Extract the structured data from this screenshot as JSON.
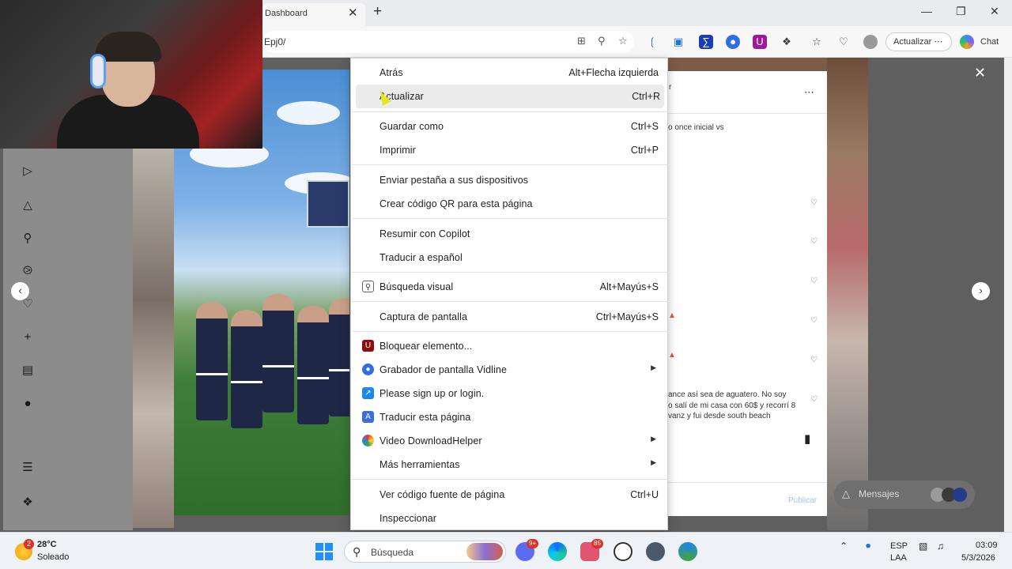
{
  "browser": {
    "tab_title": "Dashboard",
    "url": "Epj0/",
    "update_label": "Actualizar",
    "update_more": "⋯",
    "chat_label": "Chat"
  },
  "context_menu": {
    "items": [
      {
        "label": "Atrás",
        "shortcut": "Alt+Flecha izquierda"
      },
      {
        "label": "Actualizar",
        "shortcut": "Ctrl+R"
      },
      {
        "label": "Guardar como",
        "shortcut": "Ctrl+S"
      },
      {
        "label": "Imprimir",
        "shortcut": "Ctrl+P"
      },
      {
        "label": "Enviar pestaña a sus dispositivos",
        "shortcut": ""
      },
      {
        "label": "Crear código QR para esta página",
        "shortcut": ""
      },
      {
        "label": "Resumir con Copilot",
        "shortcut": ""
      },
      {
        "label": "Traducir a español",
        "shortcut": ""
      },
      {
        "label": "Búsqueda visual",
        "shortcut": "Alt+Mayús+S"
      },
      {
        "label": "Captura de pantalla",
        "shortcut": "Ctrl+Mayús+S"
      },
      {
        "label": "Bloquear elemento...",
        "shortcut": ""
      },
      {
        "label": "Grabador de pantalla Vidline",
        "shortcut": ""
      },
      {
        "label": "Please sign up or login.",
        "shortcut": ""
      },
      {
        "label": "Traducir esta página",
        "shortcut": ""
      },
      {
        "label": "Video DownloadHelper",
        "shortcut": ""
      },
      {
        "label": "Más herramientas",
        "shortcut": ""
      },
      {
        "label": "Ver código fuente de página",
        "shortcut": "Ctrl+U"
      },
      {
        "label": "Inspeccionar",
        "shortcut": ""
      }
    ]
  },
  "post_panel": {
    "header_partial": "r",
    "caption_partial": "o once inicial vs",
    "comment_1": "ance así sea de aguatero. No soy",
    "comment_2": "o salí de mi casa con 60$ y recorrí 8",
    "comment_3": "vanz y fui desde south beach",
    "publish_label": "Publicar",
    "messages_label": "Mensajes"
  },
  "taskbar": {
    "temperature": "28°C",
    "condition": "Soleado",
    "weather_badge": "2",
    "search_placeholder": "Búsqueda",
    "messenger_badge": "9+",
    "app_badge": "85",
    "language_1": "ESP",
    "language_2": "LAA",
    "time": "03:09",
    "date": "5/3/2026"
  }
}
